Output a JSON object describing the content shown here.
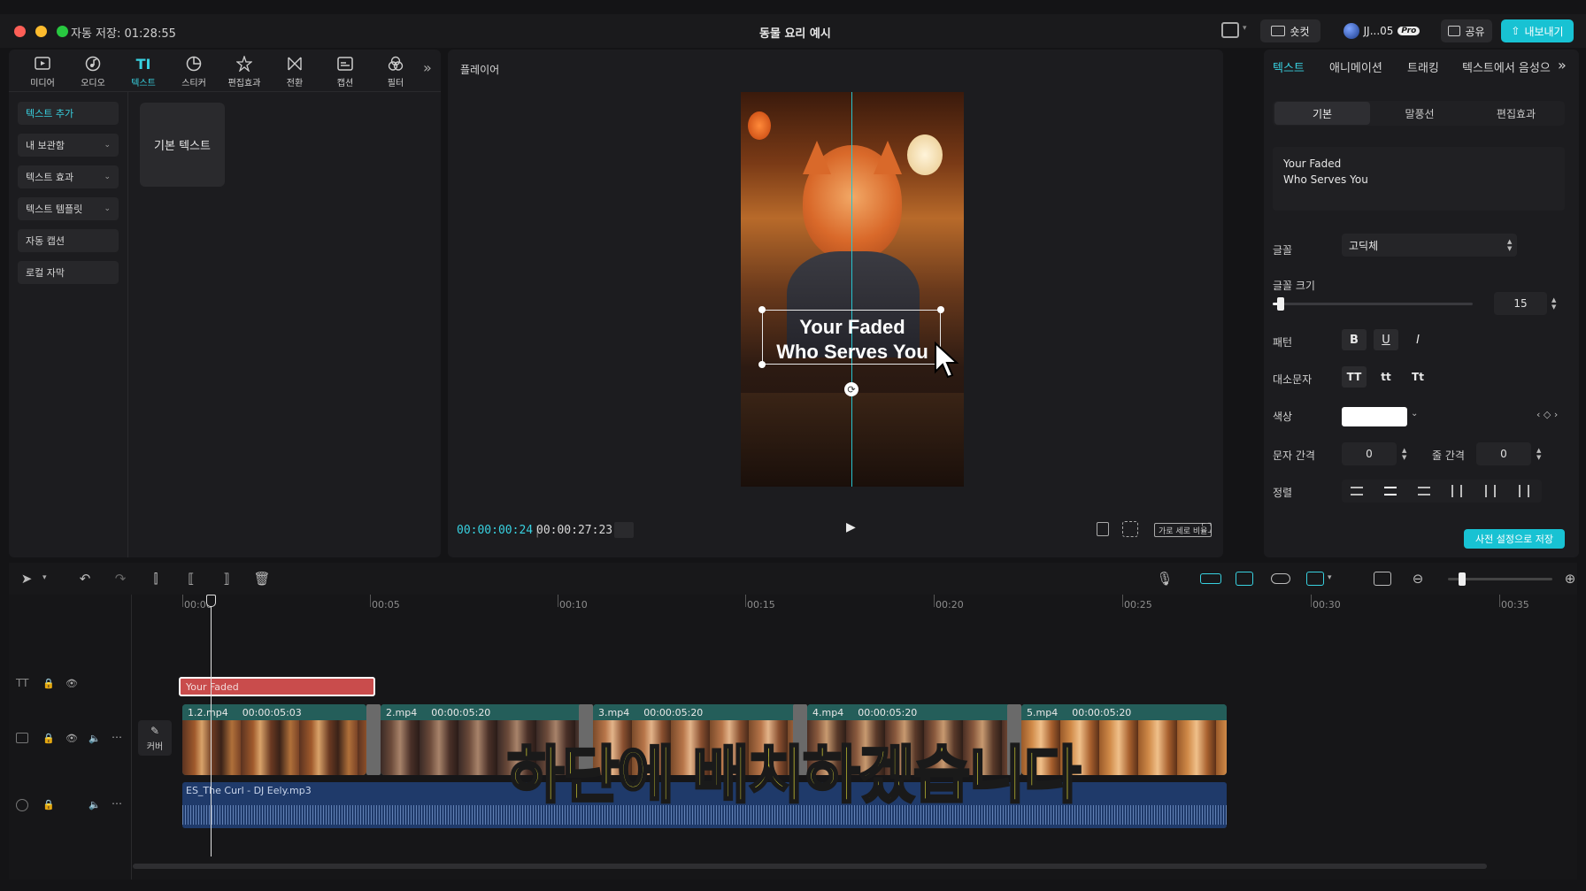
{
  "window": {
    "autosave": "자동 저장: 01:28:55",
    "title": "동물 요리 예시",
    "shortcut_label": "숏컷",
    "user_label": "JJ...05",
    "pro_badge": "Pro",
    "share_label": "공유",
    "export_label": "내보내기"
  },
  "toolbar": {
    "tools": [
      {
        "label": "미디어",
        "icon": "media-icon"
      },
      {
        "label": "오디오",
        "icon": "audio-icon"
      },
      {
        "label": "텍스트",
        "icon": "text-icon",
        "glyph": "TI"
      },
      {
        "label": "스티커",
        "icon": "sticker-icon"
      },
      {
        "label": "편집효과",
        "icon": "effects-icon"
      },
      {
        "label": "전환",
        "icon": "transition-icon"
      },
      {
        "label": "캡션",
        "icon": "caption-icon"
      },
      {
        "label": "필터",
        "icon": "filter-icon"
      }
    ],
    "more": "»"
  },
  "sidebar": {
    "items": [
      {
        "label": "텍스트 추가"
      },
      {
        "label": "내 보관함"
      },
      {
        "label": "텍스트 효과"
      },
      {
        "label": "텍스트 템플릿"
      },
      {
        "label": "자동 캡션"
      },
      {
        "label": "로컬 자막"
      }
    ],
    "default_text_card": "기본 텍스트"
  },
  "player": {
    "title": "플레이어",
    "overlay_line1": "Your Faded",
    "overlay_line2": "Who Serves You",
    "current_time": "00:00:00:24",
    "total_time": "00:00:27:23",
    "ratio_label": "가로 세로 비율"
  },
  "inspector": {
    "tabs": [
      "텍스트",
      "애니메이션",
      "트래킹",
      "텍스트에서 음성으"
    ],
    "tabs_more": "»",
    "subtabs": [
      "기본",
      "말풍선",
      "편집효과"
    ],
    "text_line1": "Your Faded",
    "text_line2": "Who Serves You",
    "font_label": "글꼴",
    "font_value": "고딕체",
    "font_size_label": "글꼴 크기",
    "font_size_value": "15",
    "font_size_fraction": 0.04,
    "pattern_label": "패턴",
    "bold": "B",
    "underline": "U",
    "italic": "I",
    "case_label": "대소문자",
    "case_upper": "TT",
    "case_lower": "tt",
    "case_title": "Tt",
    "color_label": "색상",
    "color_value": "#ffffff",
    "letter_spacing_label": "문자 간격",
    "letter_spacing_value": "0",
    "line_spacing_label": "줄 간격",
    "line_spacing_value": "0",
    "align_label": "정렬",
    "save_preset": "사전 설정으로 저장"
  },
  "timeline": {
    "ruler": [
      "00:00",
      "00:05",
      "00:10",
      "00:15",
      "00:20",
      "00:25",
      "00:30",
      "00:35"
    ],
    "text_clip": "Your Faded",
    "cover_label": "커버",
    "video_clips": [
      {
        "name": "1.2.mp4",
        "duration": "00:00:05:03"
      },
      {
        "name": "2.mp4",
        "duration": "00:00:05:20"
      },
      {
        "name": "3.mp4",
        "duration": "00:00:05:20"
      },
      {
        "name": "4.mp4",
        "duration": "00:00:05:20"
      },
      {
        "name": "5.mp4",
        "duration": "00:00:05:20"
      }
    ],
    "audio_clip": "ES_The Curl - DJ Eely.mp3",
    "subtitle": "하단에 배치하겠습니다"
  },
  "colors": {
    "accent": "#38d1e0",
    "text_clip": "#c94c4c",
    "video_track": "#2b6f6a",
    "audio_track": "#1f3a6a",
    "subtitle_yellow": "#f5f03a"
  }
}
